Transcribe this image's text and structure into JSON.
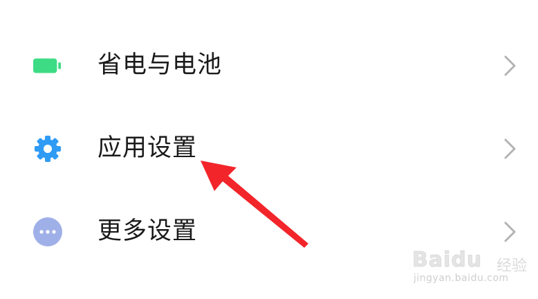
{
  "settings": {
    "items": [
      {
        "label": "省电与电池",
        "icon": "battery-icon",
        "icon_color": "#3ddc84"
      },
      {
        "label": "应用设置",
        "icon": "gear-icon",
        "icon_color": "#2f9bf5"
      },
      {
        "label": "更多设置",
        "icon": "more-dots-icon",
        "icon_color": "#9fb0e8"
      }
    ]
  },
  "annotation": {
    "arrow_color": "#f2252b"
  },
  "watermark": {
    "brand": "Baidu",
    "sub": "经验",
    "url": "jingyan.baidu.com"
  }
}
